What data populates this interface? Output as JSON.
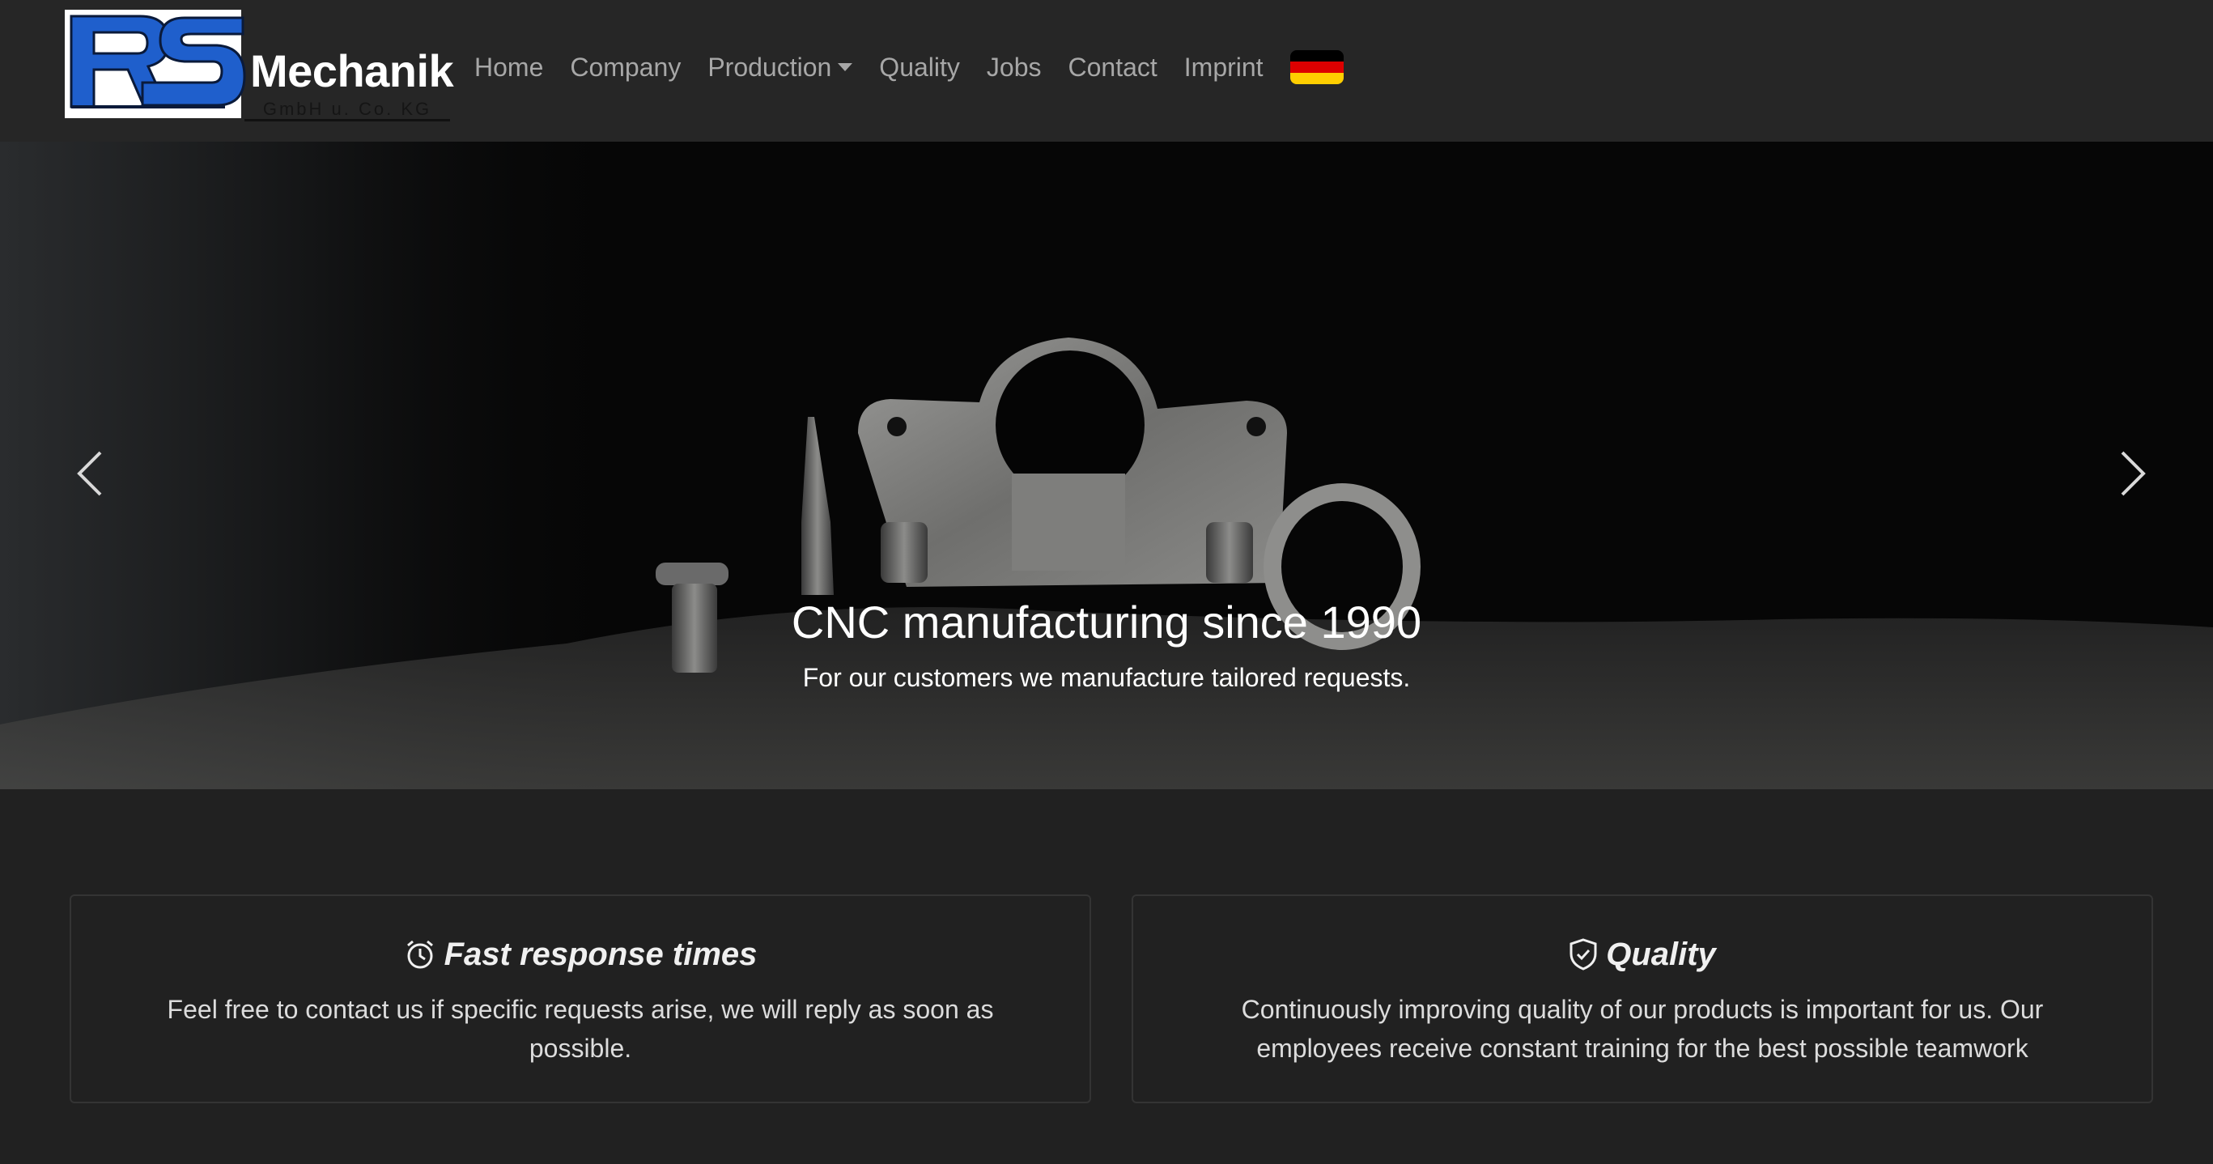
{
  "brand": {
    "name": "Mechanik",
    "subtitle": "GmbH u. Co. KG",
    "logo_letters": "RS",
    "logo_blue": "#1f5fcc"
  },
  "nav": {
    "items": [
      {
        "label": "Home"
      },
      {
        "label": "Company"
      },
      {
        "label": "Production",
        "dropdown": true
      },
      {
        "label": "Quality"
      },
      {
        "label": "Jobs"
      },
      {
        "label": "Contact"
      },
      {
        "label": "Imprint"
      }
    ],
    "language_flag": "german-flag-icon"
  },
  "hero": {
    "title": "CNC manufacturing since 1990",
    "subtitle": "For our customers we manufacture tailored requests.",
    "prev_icon": "chevron-left-icon",
    "next_icon": "chevron-right-icon"
  },
  "features": [
    {
      "icon": "alarm-clock-icon",
      "title": "Fast response times",
      "text": "Feel free to contact us if specific requests arise, we will reply as soon as possible."
    },
    {
      "icon": "shield-check-icon",
      "title": "Quality",
      "text": "Continuously improving quality of our products is important for us. Our employees receive constant training for the best possible teamwork"
    }
  ],
  "colors": {
    "background": "#212121",
    "navbar": "#262626",
    "nav_link": "#a7a7a7",
    "flag_black": "#000000",
    "flag_red": "#dd0000",
    "flag_gold": "#ffce00"
  }
}
